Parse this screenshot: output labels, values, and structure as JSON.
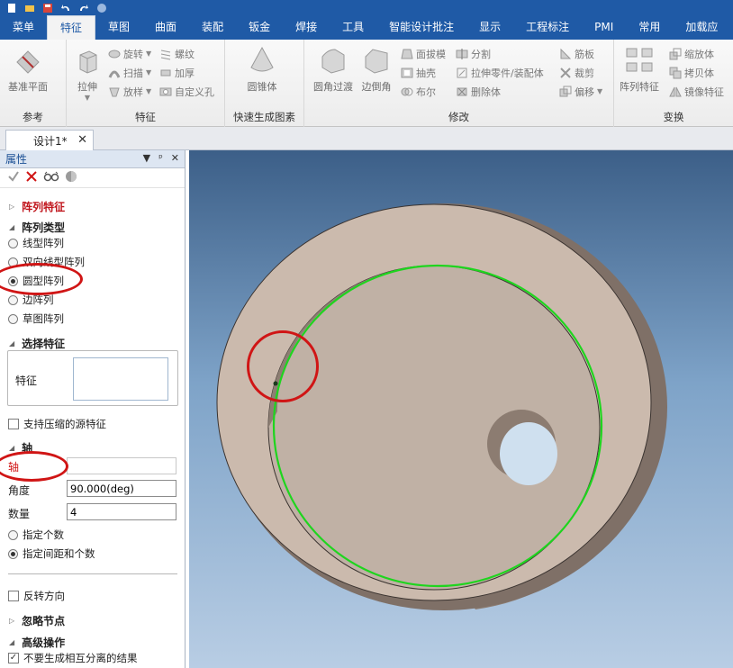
{
  "quick_access": [
    "new-icon",
    "open-icon",
    "save-icon",
    "undo-icon",
    "redo-icon",
    "help-icon"
  ],
  "tabs": [
    "菜单",
    "特征",
    "草图",
    "曲面",
    "装配",
    "钣金",
    "焊接",
    "工具",
    "智能设计批注",
    "显示",
    "工程标注",
    "PMI",
    "常用",
    "加载应"
  ],
  "active_tab": "特征",
  "ribbon": {
    "groups": {
      "reference": "参考",
      "feature": "特征",
      "quick": "快速生成图素",
      "modify": "修改",
      "transform": "变换"
    },
    "buttons": {
      "datum_plane": "基准平面",
      "extrude": "拉伸",
      "revolve": "旋转",
      "sweep": "扫描",
      "loft": "放样",
      "thread": "螺纹",
      "thicken": "加厚",
      "custom_hole": "自定义孔",
      "cone": "圆锥体",
      "fillet": "圆角过渡",
      "chamfer": "边倒角",
      "draft": "面拔模",
      "shell": "抽壳",
      "boolean": "布尔",
      "split": "分割",
      "extrude_to": "拉伸零件/装配体",
      "delete_body": "删除体",
      "rib": "筋板",
      "trim": "裁剪",
      "offset": "偏移",
      "pattern": "阵列特征",
      "scale": "缩放体",
      "copy": "拷贝体",
      "mirror": "镜像特征"
    }
  },
  "doc_tab": "设计1*",
  "panel": {
    "title": "属性",
    "pattern_feature": "阵列特征",
    "pattern_type_label": "阵列类型",
    "pattern_types": [
      "线型阵列",
      "双向线型阵列",
      "圆型阵列",
      "边阵列",
      "草图阵列"
    ],
    "selected_type": "圆型阵列",
    "select_feature_label": "选择特征",
    "feature_label": "特征",
    "support_compressed": "支持压缩的源特征",
    "axis_section": "轴",
    "axis_label": "轴",
    "axis_value": "",
    "angle_label": "角度",
    "angle_value": "90.000(deg)",
    "count_label": "数量",
    "count_value": "4",
    "spacing_options": [
      "指定个数",
      "指定间距和个数"
    ],
    "selected_spacing": "指定间距和个数",
    "reverse_direction": "反转方向",
    "ignore_nodes": "忽略节点",
    "advanced": "高级操作",
    "no_separate": "不要生成相互分离的结果"
  },
  "colors": {
    "ribbon_blue": "#1f5aa6",
    "highlight_red": "#d01515",
    "selection_green": "#22cc22",
    "part_body": "#cbbaad"
  }
}
